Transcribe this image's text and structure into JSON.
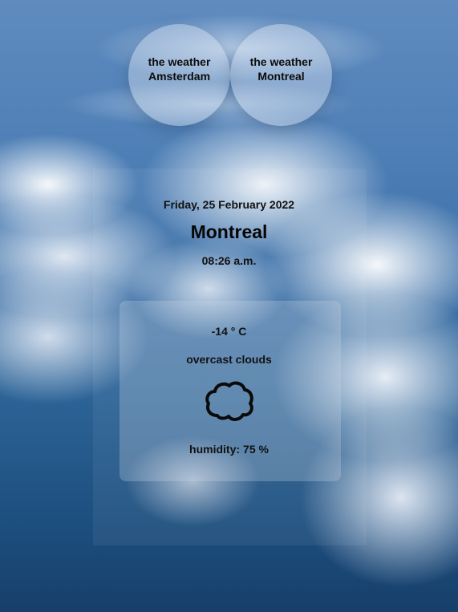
{
  "city_buttons": [
    {
      "line1": "the weather",
      "line2": "Amsterdam"
    },
    {
      "line1": "the weather",
      "line2": "Montreal"
    }
  ],
  "weather": {
    "date": "Friday, 25 February 2022",
    "city": "Montreal",
    "time": "08:26 a.m.",
    "temperature": "-14 ° C",
    "description": "overcast clouds",
    "icon": "cloud-icon",
    "humidity_label": "humidity:",
    "humidity_value": "75 %"
  }
}
